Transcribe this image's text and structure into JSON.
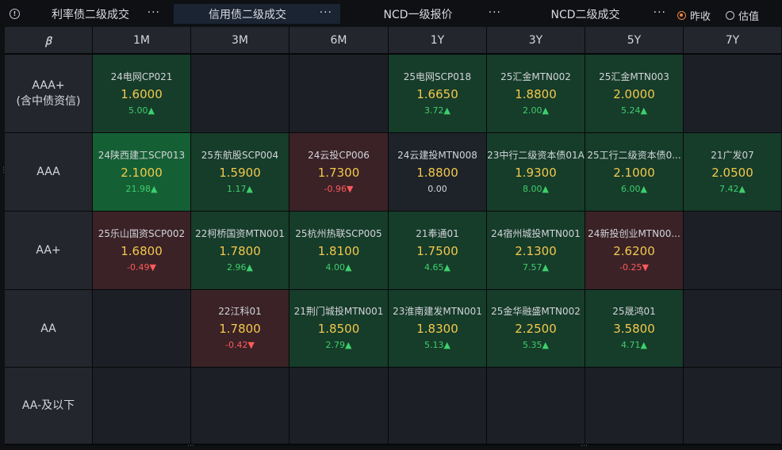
{
  "tabs": [
    {
      "label": "利率债二级成交",
      "more": "···",
      "active": false
    },
    {
      "label": "信用债二级成交",
      "more": "···",
      "active": true
    },
    {
      "label": "NCD一级报价",
      "more": "···",
      "active": false
    },
    {
      "label": "NCD二级成交",
      "more": "···",
      "active": false
    }
  ],
  "options": [
    {
      "label": "昨收",
      "selected": true
    },
    {
      "label": "估值",
      "selected": false
    }
  ],
  "icons": {
    "info": "info-icon",
    "corner": "ꞵ",
    "more": "more-icon"
  },
  "columns": [
    "1M",
    "3M",
    "6M",
    "1Y",
    "3Y",
    "5Y",
    "7Y"
  ],
  "rows": [
    {
      "label": "AAA+\n(含中债资信)",
      "cells": [
        {
          "name": "24电网CP021",
          "yield": "1.6000",
          "change": "5.00▲",
          "dir": "up",
          "tone": "g2"
        },
        null,
        null,
        {
          "name": "25电网SCP018",
          "yield": "1.6650",
          "change": "3.72▲",
          "dir": "up",
          "tone": "g2"
        },
        {
          "name": "25汇金MTN002",
          "yield": "1.8800",
          "change": "2.00▲",
          "dir": "up",
          "tone": "g2"
        },
        {
          "name": "25汇金MTN003",
          "yield": "2.0000",
          "change": "5.24▲",
          "dir": "up",
          "tone": "g2"
        },
        null
      ]
    },
    {
      "label": "AAA",
      "cells": [
        {
          "name": "24陕西建工SCP013",
          "yield": "2.1000",
          "change": "21.98▲",
          "dir": "up",
          "tone": "g3"
        },
        {
          "name": "25东航股SCP004",
          "yield": "1.5900",
          "change": "1.17▲",
          "dir": "up",
          "tone": "g2"
        },
        {
          "name": "24云投CP006",
          "yield": "1.7300",
          "change": "-0.96▼",
          "dir": "down",
          "tone": "r1"
        },
        {
          "name": "24云建投MTN008",
          "yield": "1.8800",
          "change": "0.00",
          "dir": "flat",
          "tone": "n"
        },
        {
          "name": "23中行二级资本债01A",
          "yield": "1.9300",
          "change": "8.00▲",
          "dir": "up",
          "tone": "g2"
        },
        {
          "name": "25工行二级资本债0...",
          "yield": "2.1000",
          "change": "6.00▲",
          "dir": "up",
          "tone": "g2"
        },
        {
          "name": "21广发07",
          "yield": "2.0500",
          "change": "7.42▲",
          "dir": "up",
          "tone": "g2"
        }
      ]
    },
    {
      "label": "AA+",
      "cells": [
        {
          "name": "25乐山国资SCP002",
          "yield": "1.6800",
          "change": "-0.49▼",
          "dir": "down",
          "tone": "r1"
        },
        {
          "name": "22柯桥国资MTN001",
          "yield": "1.7800",
          "change": "2.96▲",
          "dir": "up",
          "tone": "g2"
        },
        {
          "name": "25杭州热联SCP005",
          "yield": "1.8100",
          "change": "4.00▲",
          "dir": "up",
          "tone": "g2"
        },
        {
          "name": "21奉通01",
          "yield": "1.7500",
          "change": "4.65▲",
          "dir": "up",
          "tone": "g2"
        },
        {
          "name": "24宿州城投MTN001",
          "yield": "2.1300",
          "change": "7.57▲",
          "dir": "up",
          "tone": "g2"
        },
        {
          "name": "24新投创业MTN00...",
          "yield": "2.6200",
          "change": "-0.25▼",
          "dir": "down",
          "tone": "r1"
        },
        null
      ]
    },
    {
      "label": "AA",
      "cells": [
        null,
        {
          "name": "22江科01",
          "yield": "1.7800",
          "change": "-0.42▼",
          "dir": "down",
          "tone": "r1"
        },
        {
          "name": "21荆门城投MTN001",
          "yield": "1.8500",
          "change": "2.79▲",
          "dir": "up",
          "tone": "g2"
        },
        {
          "name": "23淮南建发MTN001",
          "yield": "1.8300",
          "change": "5.13▲",
          "dir": "up",
          "tone": "g2"
        },
        {
          "name": "25金华融盛MTN002",
          "yield": "2.2500",
          "change": "5.35▲",
          "dir": "up",
          "tone": "g2"
        },
        {
          "name": "25晟鸿01",
          "yield": "3.5800",
          "change": "4.71▲",
          "dir": "up",
          "tone": "g2"
        },
        null
      ]
    },
    {
      "label": "AA-及以下",
      "cells": [
        null,
        null,
        null,
        null,
        null,
        null,
        null
      ]
    }
  ],
  "colors": {
    "accent": "#f0883a",
    "up": "#3ecf6b",
    "down": "#ff5a5a",
    "yield": "#f2c94c"
  }
}
